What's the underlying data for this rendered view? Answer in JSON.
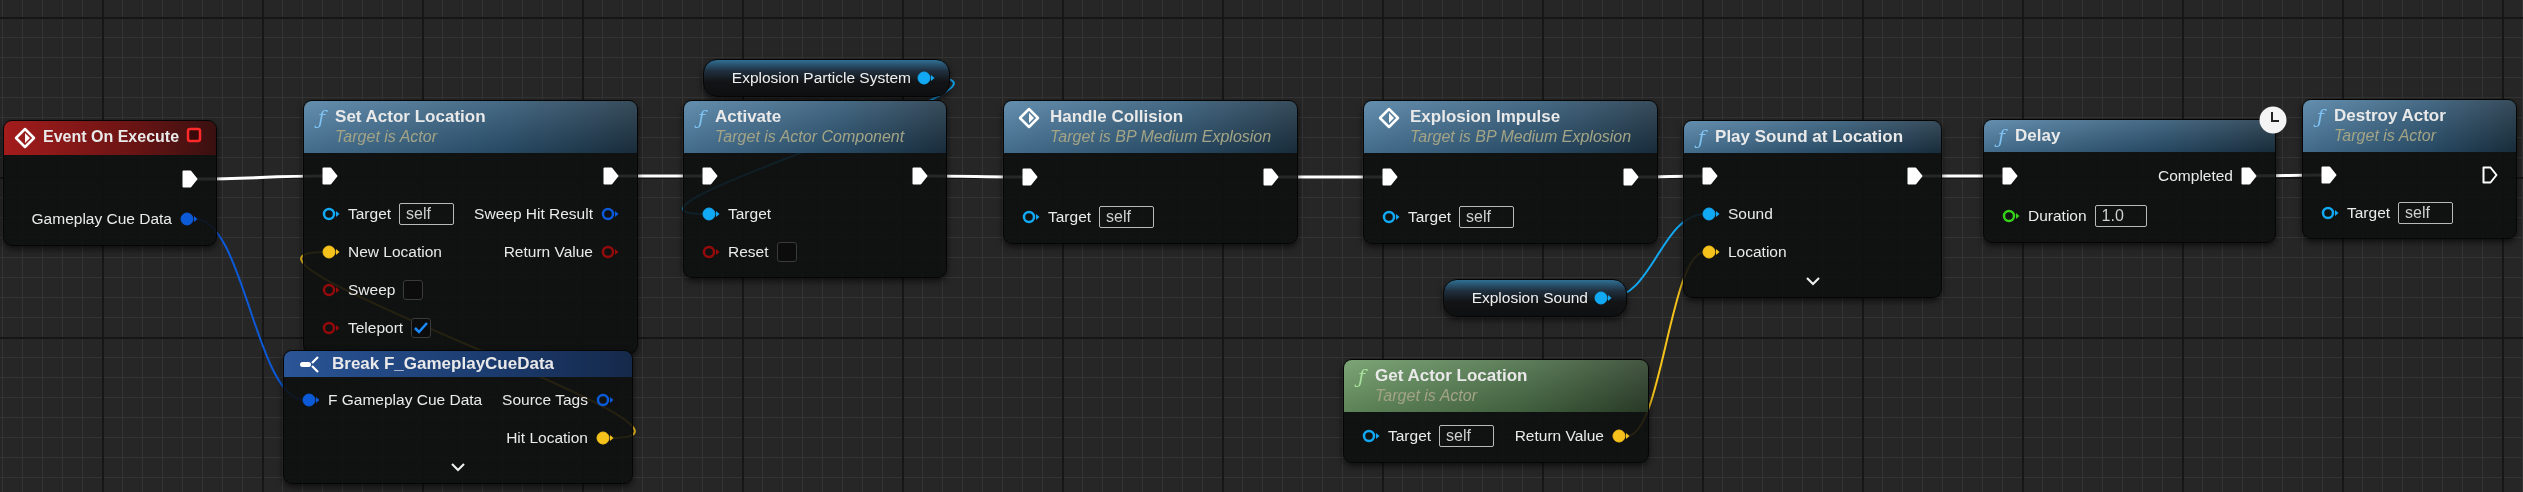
{
  "nodes": [
    {
      "kind": "event",
      "title": "Event On Execute",
      "rows": [
        {
          "out": {
            "kind": "exec",
            "connected": true
          }
        },
        {
          "out": {
            "kind": "struct",
            "label": "Gameplay Cue Data",
            "connected": true
          }
        }
      ]
    },
    {
      "kind": "function",
      "glyph": "ƒ",
      "title": "Set Actor Location",
      "subtitle": "Target is Actor",
      "rows": [
        {
          "in": {
            "kind": "exec",
            "connected": true
          },
          "out": {
            "kind": "exec",
            "connected": true
          }
        },
        {
          "in": {
            "kind": "object",
            "label": "Target",
            "connected": false,
            "value": "self"
          },
          "out": {
            "kind": "struct",
            "label": "Sweep Hit Result",
            "connected": false
          }
        },
        {
          "in": {
            "kind": "vector",
            "label": "New Location",
            "connected": true
          },
          "out": {
            "kind": "bool",
            "label": "Return Value",
            "connected": false
          }
        },
        {
          "in": {
            "kind": "bool",
            "label": "Sweep",
            "connected": false,
            "checked": false
          }
        },
        {
          "in": {
            "kind": "bool",
            "label": "Teleport",
            "connected": false,
            "checked": true
          }
        }
      ]
    },
    {
      "kind": "break",
      "title": "Break F_GameplayCueData",
      "advanced": true,
      "rows": [
        {
          "in": {
            "kind": "struct",
            "label": "F Gameplay Cue Data",
            "connected": true
          },
          "out": {
            "kind": "struct",
            "label": "Source Tags",
            "connected": false
          }
        },
        {
          "out": {
            "kind": "vector",
            "label": "Hit Location",
            "connected": true
          }
        }
      ]
    },
    {
      "kind": "variable",
      "label": "Explosion Particle System",
      "pin": {
        "kind": "object",
        "connected": true
      }
    },
    {
      "kind": "function",
      "glyph": "ƒ",
      "title": "Activate",
      "subtitle": "Target is Actor Component",
      "rows": [
        {
          "in": {
            "kind": "exec",
            "connected": true
          },
          "out": {
            "kind": "exec",
            "connected": true
          }
        },
        {
          "in": {
            "kind": "object",
            "label": "Target",
            "connected": true
          }
        },
        {
          "in": {
            "kind": "bool",
            "label": "Reset",
            "connected": false,
            "checked": false
          }
        }
      ]
    },
    {
      "kind": "event_call",
      "title": "Handle Collision",
      "subtitle": "Target is BP Medium Explosion",
      "rows": [
        {
          "in": {
            "kind": "exec",
            "connected": true
          },
          "out": {
            "kind": "exec",
            "connected": true
          }
        },
        {
          "in": {
            "kind": "object",
            "label": "Target",
            "connected": false,
            "value": "self"
          }
        }
      ]
    },
    {
      "kind": "event_call",
      "title": "Explosion Impulse",
      "subtitle": "Target is BP Medium Explosion",
      "rows": [
        {
          "in": {
            "kind": "exec",
            "connected": true
          },
          "out": {
            "kind": "exec",
            "connected": true
          }
        },
        {
          "in": {
            "kind": "object",
            "label": "Target",
            "connected": false,
            "value": "self"
          }
        }
      ]
    },
    {
      "kind": "variable",
      "label": "Explosion Sound",
      "pin": {
        "kind": "object",
        "connected": true
      }
    },
    {
      "kind": "pure",
      "glyph": "ƒ",
      "title": "Get Actor Location",
      "subtitle": "Target is Actor",
      "rows": [
        {
          "in": {
            "kind": "object",
            "label": "Target",
            "connected": false,
            "value": "self"
          },
          "out": {
            "kind": "vector",
            "label": "Return Value",
            "connected": true
          }
        }
      ]
    },
    {
      "kind": "function",
      "glyph": "ƒ",
      "title": "Play Sound at Location",
      "advanced": true,
      "rows": [
        {
          "in": {
            "kind": "exec",
            "connected": true
          },
          "out": {
            "kind": "exec",
            "connected": true
          }
        },
        {
          "in": {
            "kind": "object",
            "label": "Sound",
            "connected": true
          }
        },
        {
          "in": {
            "kind": "vector",
            "label": "Location",
            "connected": true
          }
        }
      ]
    },
    {
      "kind": "latent",
      "glyph": "ƒ",
      "title": "Delay",
      "rows": [
        {
          "in": {
            "kind": "exec",
            "connected": true
          },
          "out": {
            "kind": "exec",
            "label": "Completed",
            "connected": true
          }
        },
        {
          "in": {
            "kind": "float",
            "label": "Duration",
            "connected": false,
            "value": "1.0"
          }
        }
      ]
    },
    {
      "kind": "function",
      "glyph": "ƒ",
      "title": "Destroy Actor",
      "subtitle": "Target is Actor",
      "rows": [
        {
          "in": {
            "kind": "exec",
            "connected": true
          },
          "out": {
            "kind": "exec",
            "connected": false
          }
        },
        {
          "in": {
            "kind": "object",
            "label": "Target",
            "connected": false,
            "value": "self"
          }
        }
      ]
    }
  ]
}
